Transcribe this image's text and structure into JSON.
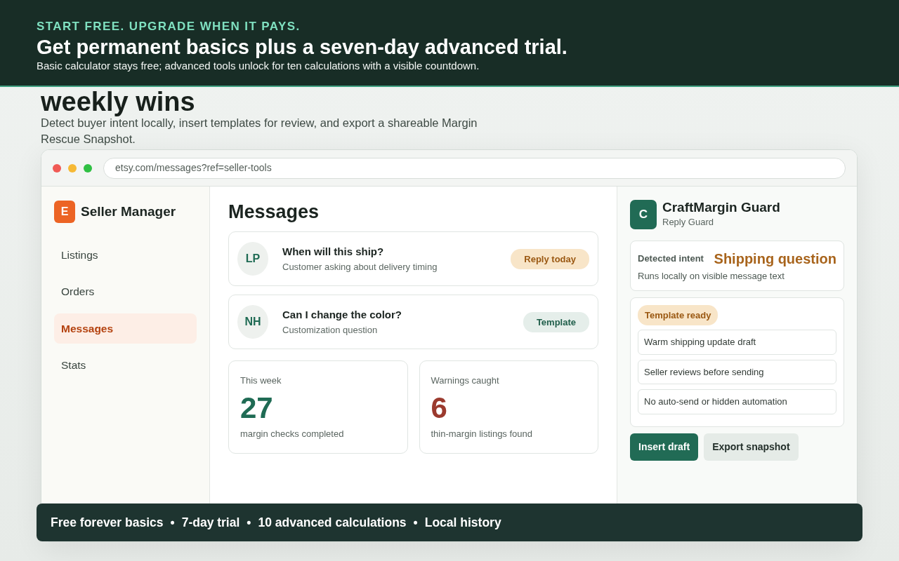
{
  "banner": {
    "eyebrow": "START FREE. UPGRADE WHEN IT PAYS.",
    "title": "Get permanent basics plus a seven-day advanced trial.",
    "subtitle": "Basic calculator stays free; advanced tools unlock for ten calculations with a visible countdown."
  },
  "hero": {
    "heading": "weekly wins",
    "text": "Detect buyer intent locally, insert templates for review, and export a shareable Margin Rescue Snapshot."
  },
  "browser": {
    "url": "etsy.com/messages?ref=seller-tools"
  },
  "sidebar": {
    "logo_letter": "E",
    "title": "Seller Manager",
    "items": [
      {
        "label": "Listings",
        "selected": false
      },
      {
        "label": "Orders",
        "selected": false
      },
      {
        "label": "Messages",
        "selected": true
      },
      {
        "label": "Stats",
        "selected": false
      }
    ]
  },
  "main": {
    "title": "Messages",
    "messages": [
      {
        "initials": "LP",
        "subject": "When will this ship?",
        "preview": "Customer asking about delivery timing",
        "tag": "Reply today",
        "kind": "urgent"
      },
      {
        "initials": "NH",
        "subject": "Can I change the color?",
        "preview": "Customization question",
        "tag": "Template",
        "kind": "template"
      }
    ],
    "stats": [
      {
        "label": "This week",
        "value": "27",
        "caption": "margin checks completed",
        "color": "#1f6b54"
      },
      {
        "label": "Warnings caught",
        "value": "6",
        "caption": "thin-margin listings found",
        "color": "#9b3a2e"
      }
    ]
  },
  "panel": {
    "logo_letter": "C",
    "title": "CraftMargin Guard",
    "subtitle": "Reply Guard",
    "intent": {
      "label": "Detected intent",
      "value": "Shipping question",
      "note": "Runs locally on visible message text"
    },
    "template": {
      "status": "Template ready",
      "items": [
        "Warm shipping update draft",
        "Seller reviews before sending",
        "No auto-send or hidden automation"
      ]
    },
    "buttons": [
      {
        "label": "Insert draft",
        "kind": "primary"
      },
      {
        "label": "Export snapshot",
        "kind": "secondary"
      }
    ]
  },
  "footer": {
    "items": [
      "Free forever basics",
      "7-day trial",
      "10 advanced calculations",
      "Local history"
    ],
    "separator": "•"
  }
}
